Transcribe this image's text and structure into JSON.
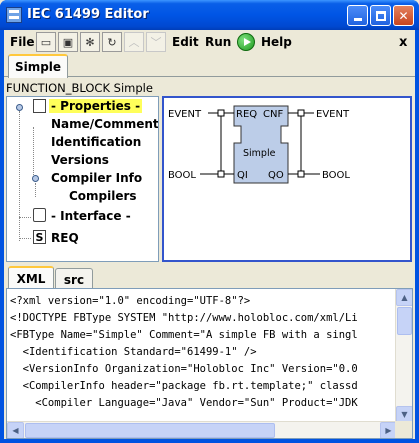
{
  "window": {
    "title": "IEC 61499 Editor"
  },
  "menubar": {
    "file": "File",
    "edit": "Edit",
    "run": "Run",
    "help": "Help",
    "close_glyph": "x"
  },
  "tabs_top": [
    "Simple"
  ],
  "fb_heading": "FUNCTION_BLOCK Simple",
  "tree": {
    "properties": "- Properties -",
    "name_comment": "Name/Comment",
    "identification": "Identification",
    "versions": "Versions",
    "compiler_info": "Compiler Info",
    "compilers": "Compilers",
    "interface": "- Interface -",
    "req": "REQ"
  },
  "diagram": {
    "event_in": "EVENT",
    "event_out": "EVENT",
    "bool_in": "BOOL",
    "bool_out": "BOOL",
    "req": "REQ",
    "cnf": "CNF",
    "name": "Simple",
    "qi": "QI",
    "qo": "QO"
  },
  "tabs_bottom": [
    "XML",
    "src"
  ],
  "xml_lines": [
    "<?xml version=\"1.0\" encoding=\"UTF-8\"?>",
    "<!DOCTYPE FBType SYSTEM \"http://www.holobloc.com/xml/Li",
    "<FBType Name=\"Simple\" Comment=\"A simple FB with a singl",
    "  <Identification Standard=\"61499-1\" />",
    "  <VersionInfo Organization=\"Holobloc Inc\" Version=\"0.0",
    "  <CompilerInfo header=\"package fb.rt.template;\" classd",
    "    <Compiler Language=\"Java\" Vendor=\"Sun\" Product=\"JDK"
  ],
  "colors": {
    "title_bar": "#0055e5",
    "selection": "#ffff5a",
    "diagram_border": "#3355cc",
    "fb_body": "#bccde8",
    "run": "#1f9a1f"
  }
}
